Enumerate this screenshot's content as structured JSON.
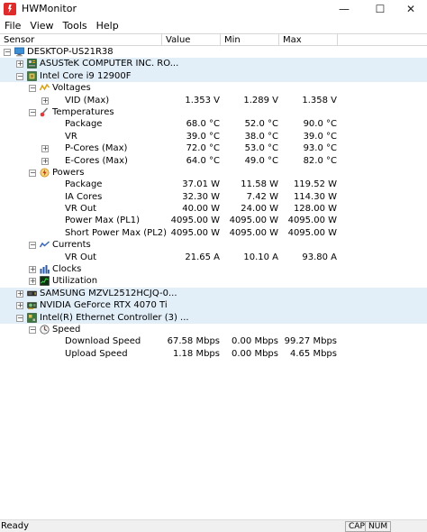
{
  "window": {
    "title": "HWMonitor",
    "min_glyph": "—",
    "max_glyph": "☐",
    "close_glyph": "✕"
  },
  "menu": [
    "File",
    "View",
    "Tools",
    "Help"
  ],
  "columns": {
    "sensor": "Sensor",
    "value": "Value",
    "min": "Min",
    "max": "Max"
  },
  "tree": [
    {
      "level": 0,
      "expander": "−",
      "icon": "computer-icon",
      "name": "DESKTOP-US21R38"
    },
    {
      "level": 1,
      "expander": "+",
      "icon": "motherboard-icon",
      "name": "ASUSTeK COMPUTER INC. RO...",
      "highlight": true
    },
    {
      "level": 1,
      "expander": "−",
      "icon": "cpu-icon",
      "name": "Intel Core i9 12900F",
      "highlight": true
    },
    {
      "level": 2,
      "expander": "−",
      "icon": "voltage-icon",
      "name": "Voltages"
    },
    {
      "level": 3,
      "expander": "+",
      "name": "VID (Max)",
      "value": "1.353 V",
      "min": "1.289 V",
      "max": "1.358 V"
    },
    {
      "level": 2,
      "expander": "−",
      "icon": "thermometer-icon",
      "name": "Temperatures"
    },
    {
      "level": 3,
      "name": "Package",
      "value": "68.0 °C",
      "min": "52.0 °C",
      "max": "90.0 °C"
    },
    {
      "level": 3,
      "name": "VR",
      "value": "39.0 °C",
      "min": "38.0 °C",
      "max": "39.0 °C"
    },
    {
      "level": 3,
      "expander": "+",
      "name": "P-Cores (Max)",
      "value": "72.0 °C",
      "min": "53.0 °C",
      "max": "93.0 °C"
    },
    {
      "level": 3,
      "expander": "+",
      "name": "E-Cores (Max)",
      "value": "64.0 °C",
      "min": "49.0 °C",
      "max": "82.0 °C"
    },
    {
      "level": 2,
      "expander": "−",
      "icon": "power-icon",
      "name": "Powers"
    },
    {
      "level": 3,
      "name": "Package",
      "value": "37.01 W",
      "min": "11.58 W",
      "max": "119.52 W"
    },
    {
      "level": 3,
      "name": "IA Cores",
      "value": "32.30 W",
      "min": "7.42 W",
      "max": "114.30 W"
    },
    {
      "level": 3,
      "name": "VR Out",
      "value": "40.00 W",
      "min": "24.00 W",
      "max": "128.00 W"
    },
    {
      "level": 3,
      "name": "Power Max (PL1)",
      "value": "4095.00 W",
      "min": "4095.00 W",
      "max": "4095.00 W"
    },
    {
      "level": 3,
      "name": "Short Power Max (PL2)",
      "value": "4095.00 W",
      "min": "4095.00 W",
      "max": "4095.00 W"
    },
    {
      "level": 2,
      "expander": "−",
      "icon": "current-icon",
      "name": "Currents"
    },
    {
      "level": 3,
      "name": "VR Out",
      "value": "21.65 A",
      "min": "10.10 A",
      "max": "93.80 A"
    },
    {
      "level": 2,
      "expander": "+",
      "icon": "clock-icon",
      "name": "Clocks"
    },
    {
      "level": 2,
      "expander": "+",
      "icon": "utilization-icon",
      "name": "Utilization"
    },
    {
      "level": 1,
      "expander": "+",
      "icon": "ssd-icon",
      "name": "SAMSUNG MZVL2512HCJQ-0...",
      "highlight": true
    },
    {
      "level": 1,
      "expander": "+",
      "icon": "gpu-icon",
      "name": "NVIDIA GeForce RTX 4070 Ti",
      "highlight": true
    },
    {
      "level": 1,
      "expander": "−",
      "icon": "network-icon",
      "name": "Intel(R) Ethernet Controller (3) ...",
      "highlight": true
    },
    {
      "level": 2,
      "expander": "−",
      "icon": "speed-icon",
      "name": "Speed"
    },
    {
      "level": 3,
      "name": "Download Speed",
      "value": "67.58 Mbps",
      "min": "0.00 Mbps",
      "max": "99.27 Mbps"
    },
    {
      "level": 3,
      "name": "Upload Speed",
      "value": "1.18 Mbps",
      "min": "0.00 Mbps",
      "max": "4.65 Mbps"
    }
  ],
  "status": {
    "text": "Ready",
    "cap": "CAP",
    "num": "NUM"
  }
}
